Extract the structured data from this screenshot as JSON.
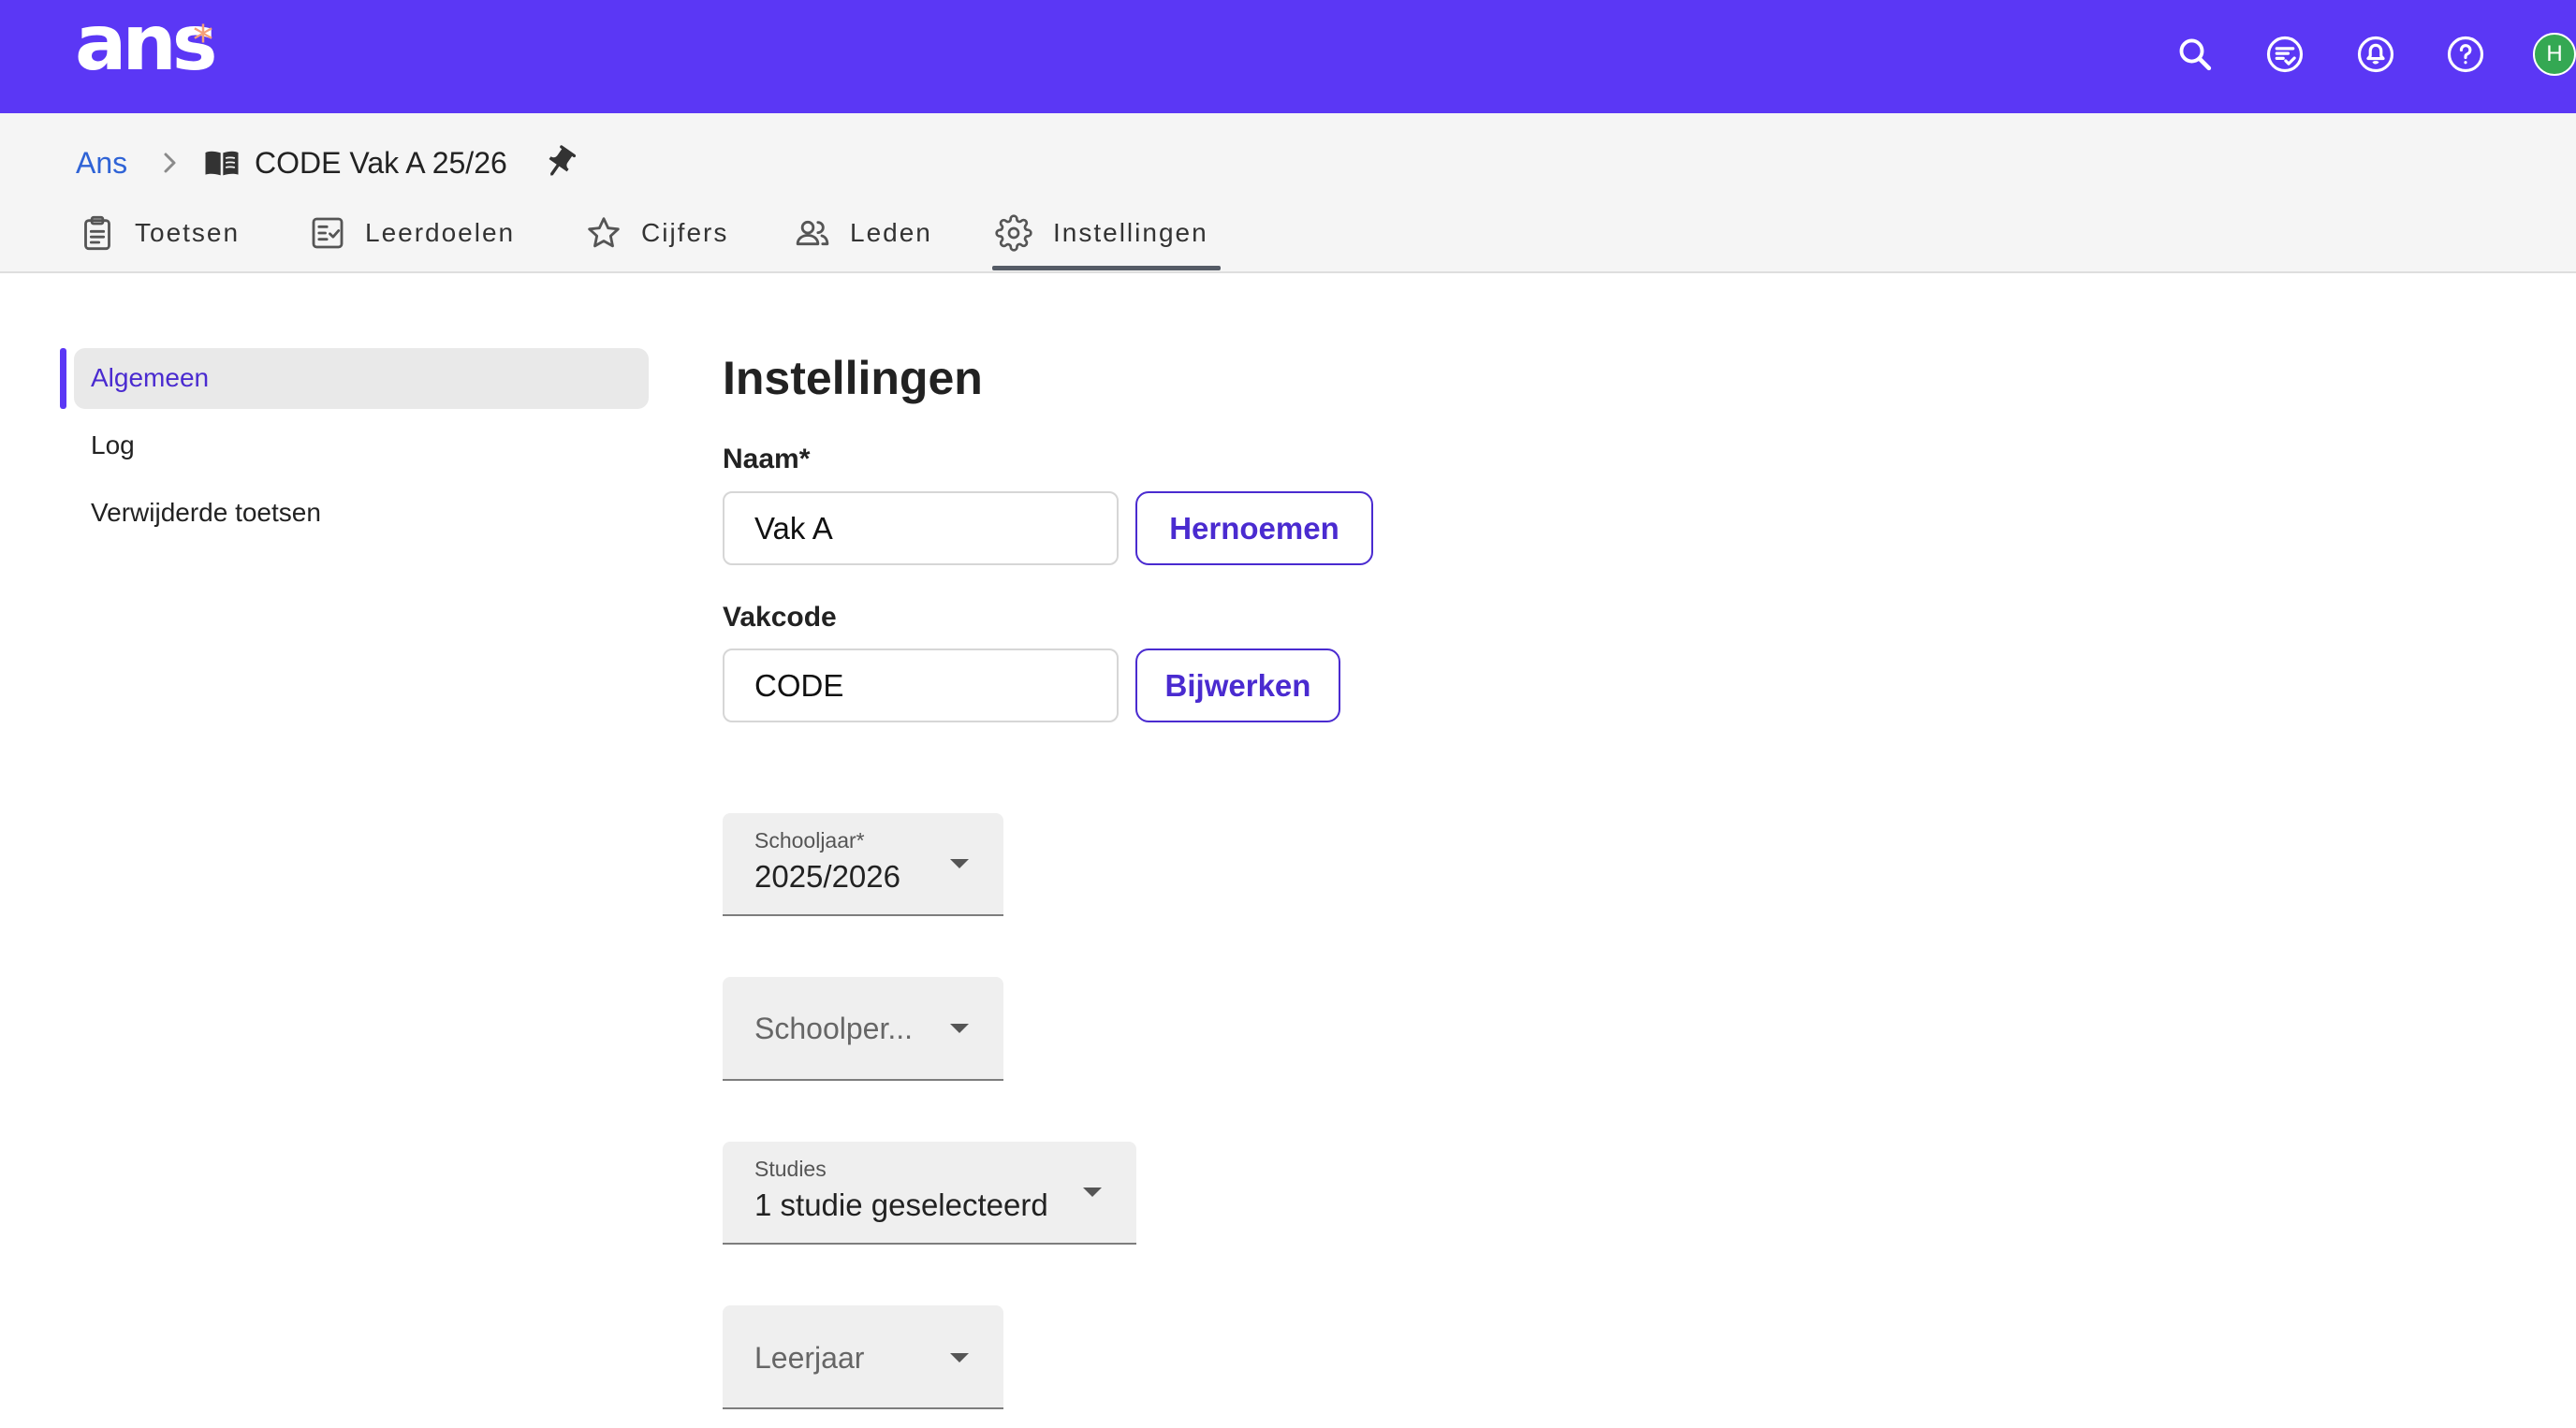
{
  "app": {
    "logo_text": "ans",
    "logo_mark": "*"
  },
  "header": {
    "icons": [
      "search-icon",
      "checklist-chat-icon",
      "notification-bell-icon",
      "help-icon"
    ],
    "avatar_initial": "H"
  },
  "breadcrumb": {
    "root": "Ans",
    "separator_icon": "chevron-right-icon",
    "course_icon": "book-open-icon",
    "current": "CODE Vak A 25/26",
    "pin_icon": "pin-icon"
  },
  "tabs": [
    {
      "label": "Toetsen",
      "icon": "clipboard-icon",
      "active": false
    },
    {
      "label": "Leerdoelen",
      "icon": "checklist-icon",
      "active": false
    },
    {
      "label": "Cijfers",
      "icon": "star-icon",
      "active": false
    },
    {
      "label": "Leden",
      "icon": "people-icon",
      "active": false
    },
    {
      "label": "Instellingen",
      "icon": "gear-icon",
      "active": true
    }
  ],
  "sidebar": {
    "items": [
      {
        "label": "Algemeen",
        "active": true
      },
      {
        "label": "Log",
        "active": false
      },
      {
        "label": "Verwijderde toetsen",
        "active": false
      }
    ]
  },
  "main": {
    "title": "Instellingen",
    "name": {
      "label": "Naam*",
      "value": "Vak A",
      "button": "Hernoemen"
    },
    "code": {
      "label": "Vakcode",
      "value": "CODE",
      "button": "Bijwerken"
    },
    "selects": [
      {
        "label": "Schooljaar*",
        "value": "2025/2026"
      },
      {
        "placeholder": "Schoolper..."
      },
      {
        "label": "Studies",
        "value": "1 studie geselecteerd"
      },
      {
        "placeholder": "Leerjaar"
      }
    ]
  },
  "colors": {
    "brand": "#5b37f5",
    "accent": "#4a2bd0",
    "link": "#2f63d6",
    "logo_mark": "#f5a07a",
    "avatar": "#34a853"
  }
}
